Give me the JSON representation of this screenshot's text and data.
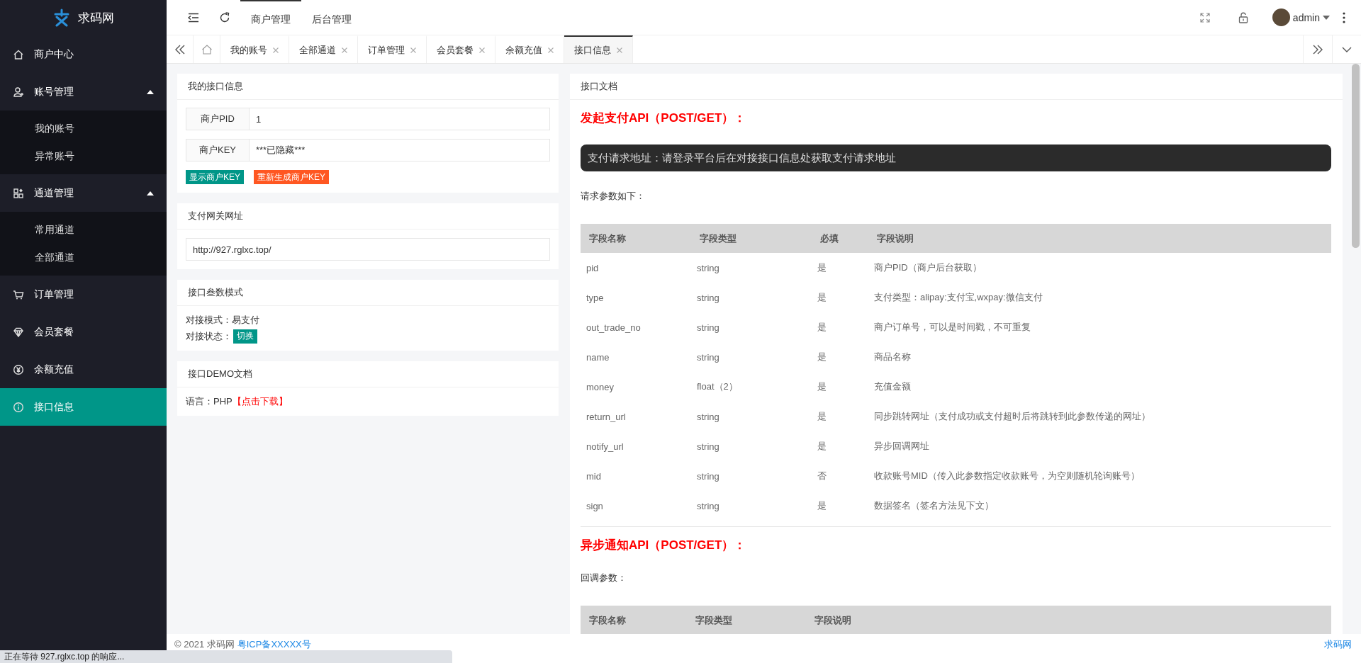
{
  "brand": {
    "name": "求码网"
  },
  "header": {
    "nav": [
      {
        "label": "商户管理",
        "selected": true
      },
      {
        "label": "后台管理",
        "selected": false
      }
    ],
    "user": "admin"
  },
  "tabs": [
    {
      "label": "我的账号",
      "selected": false
    },
    {
      "label": "全部通道",
      "selected": false
    },
    {
      "label": "订单管理",
      "selected": false
    },
    {
      "label": "会员套餐",
      "selected": false
    },
    {
      "label": "余额充值",
      "selected": false
    },
    {
      "label": "接口信息",
      "selected": true
    }
  ],
  "sidebar": {
    "items": [
      {
        "label": "商户中心",
        "selected": false
      },
      {
        "label": "账号管理",
        "selected": false,
        "expanded": true,
        "children": [
          {
            "label": "我的账号",
            "selected": false
          },
          {
            "label": "异常账号",
            "selected": false
          }
        ]
      },
      {
        "label": "通道管理",
        "selected": false,
        "expanded": true,
        "children": [
          {
            "label": "常用通道",
            "selected": false
          },
          {
            "label": "全部通道",
            "selected": false
          }
        ]
      },
      {
        "label": "订单管理",
        "selected": false
      },
      {
        "label": "会员套餐",
        "selected": false
      },
      {
        "label": "余额充值",
        "selected": false
      },
      {
        "label": "接口信息",
        "selected": true
      }
    ]
  },
  "info_card": {
    "title": "我的接口信息",
    "fields": [
      {
        "label": "商户PID",
        "value": "1"
      },
      {
        "label": "商户KEY",
        "value": "***已隐藏***"
      }
    ],
    "buttons": [
      {
        "label": "显示商户KEY",
        "color": "#009688"
      },
      {
        "label": "重新生成商户KEY",
        "color": "#ff5722"
      }
    ]
  },
  "gateway_card": {
    "title": "支付网关网址",
    "value": "http://927.rglxc.top/"
  },
  "mode_card": {
    "title": "接口叁数模式",
    "mode_label": "对接模式：",
    "mode_value": "易支付",
    "status_label": "对接状态：",
    "switch_button": "切换"
  },
  "demo_card": {
    "title": "接口DEMO文档",
    "language": "语言：PHP",
    "download_link": "【点击下载】"
  },
  "docs": {
    "title": "接口文档",
    "sections": [
      {
        "heading": "发起支付API（POST/GET）：",
        "address": "支付请求地址：请登录平台后在对接接口信息处获取支付请求地址",
        "intro": "请求参数如下：",
        "columns": [
          "字段名称",
          "字段类型",
          "必填",
          "字段说明"
        ],
        "rows": [
          [
            "pid",
            "string",
            "是",
            "商户PID（商户后台获取）"
          ],
          [
            "type",
            "string",
            "是",
            "支付类型：alipay:支付宝,wxpay:微信支付"
          ],
          [
            "out_trade_no",
            "string",
            "是",
            "商户订单号，可以是时间戳，不可重复"
          ],
          [
            "name",
            "string",
            "是",
            "商品名称"
          ],
          [
            "money",
            "float（2）",
            "是",
            "充值金额"
          ],
          [
            "return_url",
            "string",
            "是",
            "同步跳转网址（支付成功或支付超时后将跳转到此参数传递的网址）"
          ],
          [
            "notify_url",
            "string",
            "是",
            "异步回调网址"
          ],
          [
            "mid",
            "string",
            "否",
            "收款账号MID（传入此参数指定收款账号，为空则随机轮询账号）"
          ],
          [
            "sign",
            "string",
            "是",
            "数据签名（签名方法见下文）"
          ]
        ]
      },
      {
        "heading": "异步通知API（POST/GET）：",
        "intro": "回调参数：",
        "columns": [
          "字段名称",
          "字段类型",
          "字段说明"
        ]
      }
    ]
  },
  "footer": {
    "copyright": "© 2021 求码网",
    "icp": "粤ICP备XXXXX号",
    "brand_link": "求码网"
  },
  "status_bar": {
    "text": "正在等待 927.rglxc.top 的响应..."
  }
}
